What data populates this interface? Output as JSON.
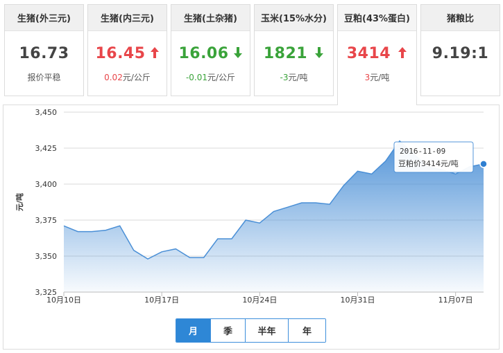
{
  "cards": [
    {
      "title": "生猪(外三元)",
      "price": "16.73",
      "trend": "flat",
      "sub": "报价平稳",
      "sub_change": "",
      "sub_unit": ""
    },
    {
      "title": "生猪(内三元)",
      "price": "16.45",
      "trend": "up",
      "sub": "",
      "sub_change": "0.02",
      "sub_unit": "元/公斤"
    },
    {
      "title": "生猪(土杂猪)",
      "price": "16.06",
      "trend": "down",
      "sub": "",
      "sub_change": "-0.01",
      "sub_unit": "元/公斤"
    },
    {
      "title": "玉米(15%水分)",
      "price": "1821",
      "trend": "down",
      "sub": "",
      "sub_change": "-3",
      "sub_unit": "元/吨"
    },
    {
      "title": "豆粕(43%蛋白)",
      "price": "3414",
      "trend": "up",
      "sub": "",
      "sub_change": "3",
      "sub_unit": "元/吨",
      "active": true
    },
    {
      "title": "猪粮比",
      "price": "9.19:1",
      "trend": "flat",
      "sub": "",
      "sub_change": "",
      "sub_unit": ""
    }
  ],
  "colors": {
    "up": "#e8464a",
    "down": "#3aa33a",
    "accent": "#2e87d6",
    "line": "#4a8fd6"
  },
  "tooltip": {
    "date": "2016-11-09",
    "label": "豆粕价",
    "value": "3414",
    "unit": "元/吨"
  },
  "range_tabs": [
    {
      "label": "月",
      "selected": true
    },
    {
      "label": "季",
      "selected": false
    },
    {
      "label": "半年",
      "selected": false
    },
    {
      "label": "年",
      "selected": false
    }
  ],
  "chart_data": {
    "type": "area",
    "ylabel": "元/吨",
    "ylim": [
      3325,
      3450
    ],
    "yticks": [
      "3,325",
      "3,350",
      "3,375",
      "3,400",
      "3,425",
      "3,450"
    ],
    "ytick_values": [
      3325,
      3350,
      3375,
      3400,
      3425,
      3450
    ],
    "xticks": [
      {
        "label": "10月10日",
        "date": "2016-10-10"
      },
      {
        "label": "10月17日",
        "date": "2016-10-17"
      },
      {
        "label": "10月24日",
        "date": "2016-10-24"
      },
      {
        "label": "10月31日",
        "date": "2016-10-31"
      },
      {
        "label": "11月07日",
        "date": "2016-11-07"
      }
    ],
    "grid": true,
    "legend": "none",
    "x": [
      "2016-10-10",
      "2016-10-11",
      "2016-10-12",
      "2016-10-13",
      "2016-10-14",
      "2016-10-15",
      "2016-10-16",
      "2016-10-17",
      "2016-10-18",
      "2016-10-19",
      "2016-10-20",
      "2016-10-21",
      "2016-10-22",
      "2016-10-23",
      "2016-10-24",
      "2016-10-25",
      "2016-10-26",
      "2016-10-27",
      "2016-10-28",
      "2016-10-29",
      "2016-10-30",
      "2016-10-31",
      "2016-11-01",
      "2016-11-02",
      "2016-11-03",
      "2016-11-04",
      "2016-11-05",
      "2016-11-06",
      "2016-11-07",
      "2016-11-08",
      "2016-11-09"
    ],
    "values": [
      3371,
      3367,
      3367,
      3368,
      3371,
      3354,
      3348,
      3353,
      3355,
      3349,
      3349,
      3362,
      3362,
      3375,
      3373,
      3381,
      3384,
      3387,
      3387,
      3386,
      3399,
      3409,
      3407,
      3416,
      3430,
      3421,
      3412,
      3410,
      3407,
      3412,
      3414
    ],
    "highlight_index": 30
  }
}
